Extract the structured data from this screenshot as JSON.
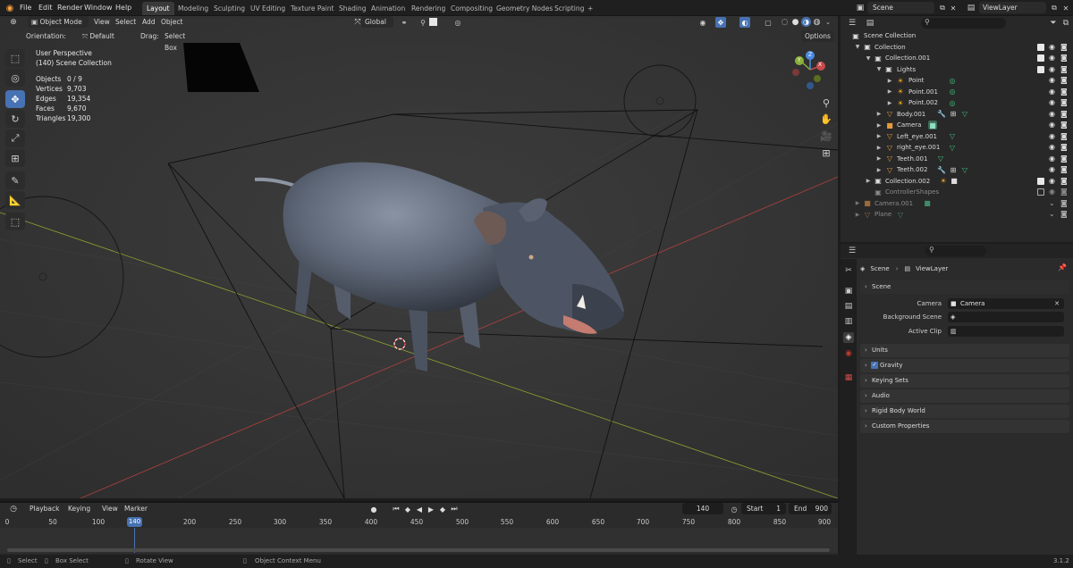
{
  "colors": {
    "accent": "#4772b3",
    "viewport_bg": "#3a3a3a",
    "x_axis": "#b34040",
    "y_axis": "#8ea62f",
    "light_icon": "#f5a623",
    "mesh_icon": "#e59a3b",
    "modifier_icon": "#48a4d8",
    "vertexgroup_icon": "#3fbf7f"
  },
  "topbar": {
    "menu": [
      "File",
      "Edit",
      "Render",
      "Window",
      "Help"
    ],
    "workspaces": [
      "Layout",
      "Modeling",
      "Sculpting",
      "UV Editing",
      "Texture Paint",
      "Shading",
      "Animation",
      "Rendering",
      "Compositing",
      "Geometry Nodes",
      "Scripting"
    ],
    "active_workspace": "Layout",
    "add_tab": "+",
    "scene": "Scene",
    "view_layer": "ViewLayer"
  },
  "viewport": {
    "mode": "Object Mode",
    "menu": [
      "View",
      "Select",
      "Add",
      "Object"
    ],
    "transform_orientation": "Global",
    "orientation_label": "Orientation:",
    "orientation_value": "Default",
    "drag_label": "Drag:",
    "drag_value": "Select Box",
    "options": "Options",
    "perspective": "User Perspective",
    "collection_info": "(140) Scene Collection",
    "stats": [
      {
        "label": "Objects",
        "value": "0 / 9"
      },
      {
        "label": "Vertices",
        "value": "9,703"
      },
      {
        "label": "Edges",
        "value": "19,354"
      },
      {
        "label": "Faces",
        "value": "9,670"
      },
      {
        "label": "Triangles",
        "value": "19,300"
      }
    ],
    "gizmo": {
      "x": "X",
      "y": "Y",
      "z": "Z"
    }
  },
  "timeline": {
    "menu": [
      "Playback",
      "Keying",
      "View",
      "Marker"
    ],
    "current_frame": "140",
    "start_label": "Start",
    "start": "1",
    "end_label": "End",
    "end": "900",
    "ticks": [
      "0",
      "50",
      "100",
      "140",
      "200",
      "250",
      "300",
      "350",
      "400",
      "450",
      "500",
      "550",
      "600",
      "650",
      "700",
      "750",
      "800",
      "850",
      "900"
    ]
  },
  "statusbar": {
    "items": [
      "Select",
      "Box Select",
      "Rotate View",
      "Object Context Menu"
    ],
    "version": "3.1.2"
  },
  "outliner": {
    "search_placeholder": "",
    "rows": [
      {
        "label": "Scene Collection",
        "icon": "scene-collection-icon",
        "depth": 0
      },
      {
        "label": "Collection",
        "icon": "collection-icon",
        "depth": 1
      },
      {
        "label": "Collection.001",
        "icon": "collection-icon",
        "depth": 2
      },
      {
        "label": "Lights",
        "icon": "collection-icon",
        "depth": 3
      },
      {
        "label": "Point",
        "icon": "light-icon",
        "depth": 4
      },
      {
        "label": "Point.001",
        "icon": "light-icon",
        "depth": 4
      },
      {
        "label": "Point.002",
        "icon": "light-icon",
        "depth": 4
      },
      {
        "label": "Body.001",
        "icon": "mesh-icon",
        "depth": 3
      },
      {
        "label": "Camera",
        "icon": "camera-icon",
        "depth": 3
      },
      {
        "label": "Left_eye.001",
        "icon": "mesh-icon",
        "depth": 3
      },
      {
        "label": "right_eye.001",
        "icon": "mesh-icon",
        "depth": 3
      },
      {
        "label": "Teeth.001",
        "icon": "mesh-icon",
        "depth": 3
      },
      {
        "label": "Teeth.002",
        "icon": "mesh-icon",
        "depth": 3
      },
      {
        "label": "Collection.002",
        "icon": "collection-icon",
        "depth": 2
      },
      {
        "label": "ControllerShapes",
        "icon": "collection-icon",
        "depth": 2
      },
      {
        "label": "Camera.001",
        "icon": "camera-icon",
        "depth": 1
      },
      {
        "label": "Plane",
        "icon": "mesh-icon",
        "depth": 1
      }
    ]
  },
  "properties": {
    "breadcrumb": [
      "Scene",
      "ViewLayer"
    ],
    "panel_title": "Scene",
    "camera_label": "Camera",
    "camera_value": "Camera",
    "background_scene_label": "Background Scene",
    "active_clip_label": "Active Clip",
    "panels": [
      "Units",
      "Gravity",
      "Keying Sets",
      "Audio",
      "Rigid Body World",
      "Custom Properties"
    ]
  }
}
